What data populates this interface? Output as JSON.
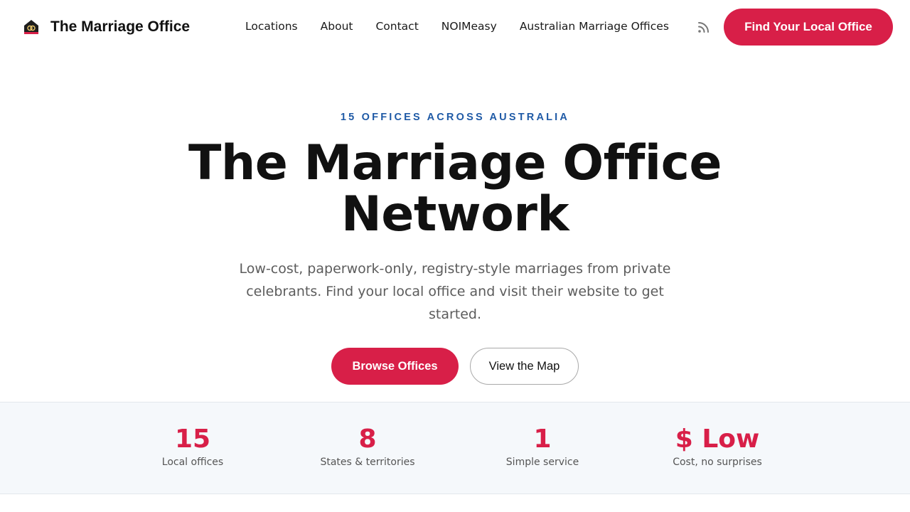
{
  "header": {
    "brand_title": "The Marriage Office",
    "logo_icon": "house-rings-icon",
    "nav": [
      {
        "label": "Locations"
      },
      {
        "label": "About"
      },
      {
        "label": "Contact"
      },
      {
        "label": "NOIMeasy"
      },
      {
        "label": "Australian Marriage Offices"
      }
    ],
    "rss_icon": "rss-icon",
    "cta_label": "Find Your Local Office"
  },
  "hero": {
    "eyebrow": "15 OFFICES ACROSS AUSTRALIA",
    "title_line1": "The Marriage Office",
    "title_line2": "Network",
    "description": "Low-cost, paperwork-only, registry-style marriages from private celebrants. Find your local office and visit their website to get started.",
    "primary_button": "Browse Offices",
    "secondary_button": "View the Map"
  },
  "stats": [
    {
      "value": "15",
      "label": "Local offices"
    },
    {
      "value": "8",
      "label": "States & territories"
    },
    {
      "value": "1",
      "label": "Simple service"
    },
    {
      "value": "$ Low",
      "label": "Cost, no surprises"
    }
  ],
  "colors": {
    "accent": "#d81f48",
    "eyebrow": "#1f5aa6",
    "stats_background": "#f5f8fb"
  }
}
